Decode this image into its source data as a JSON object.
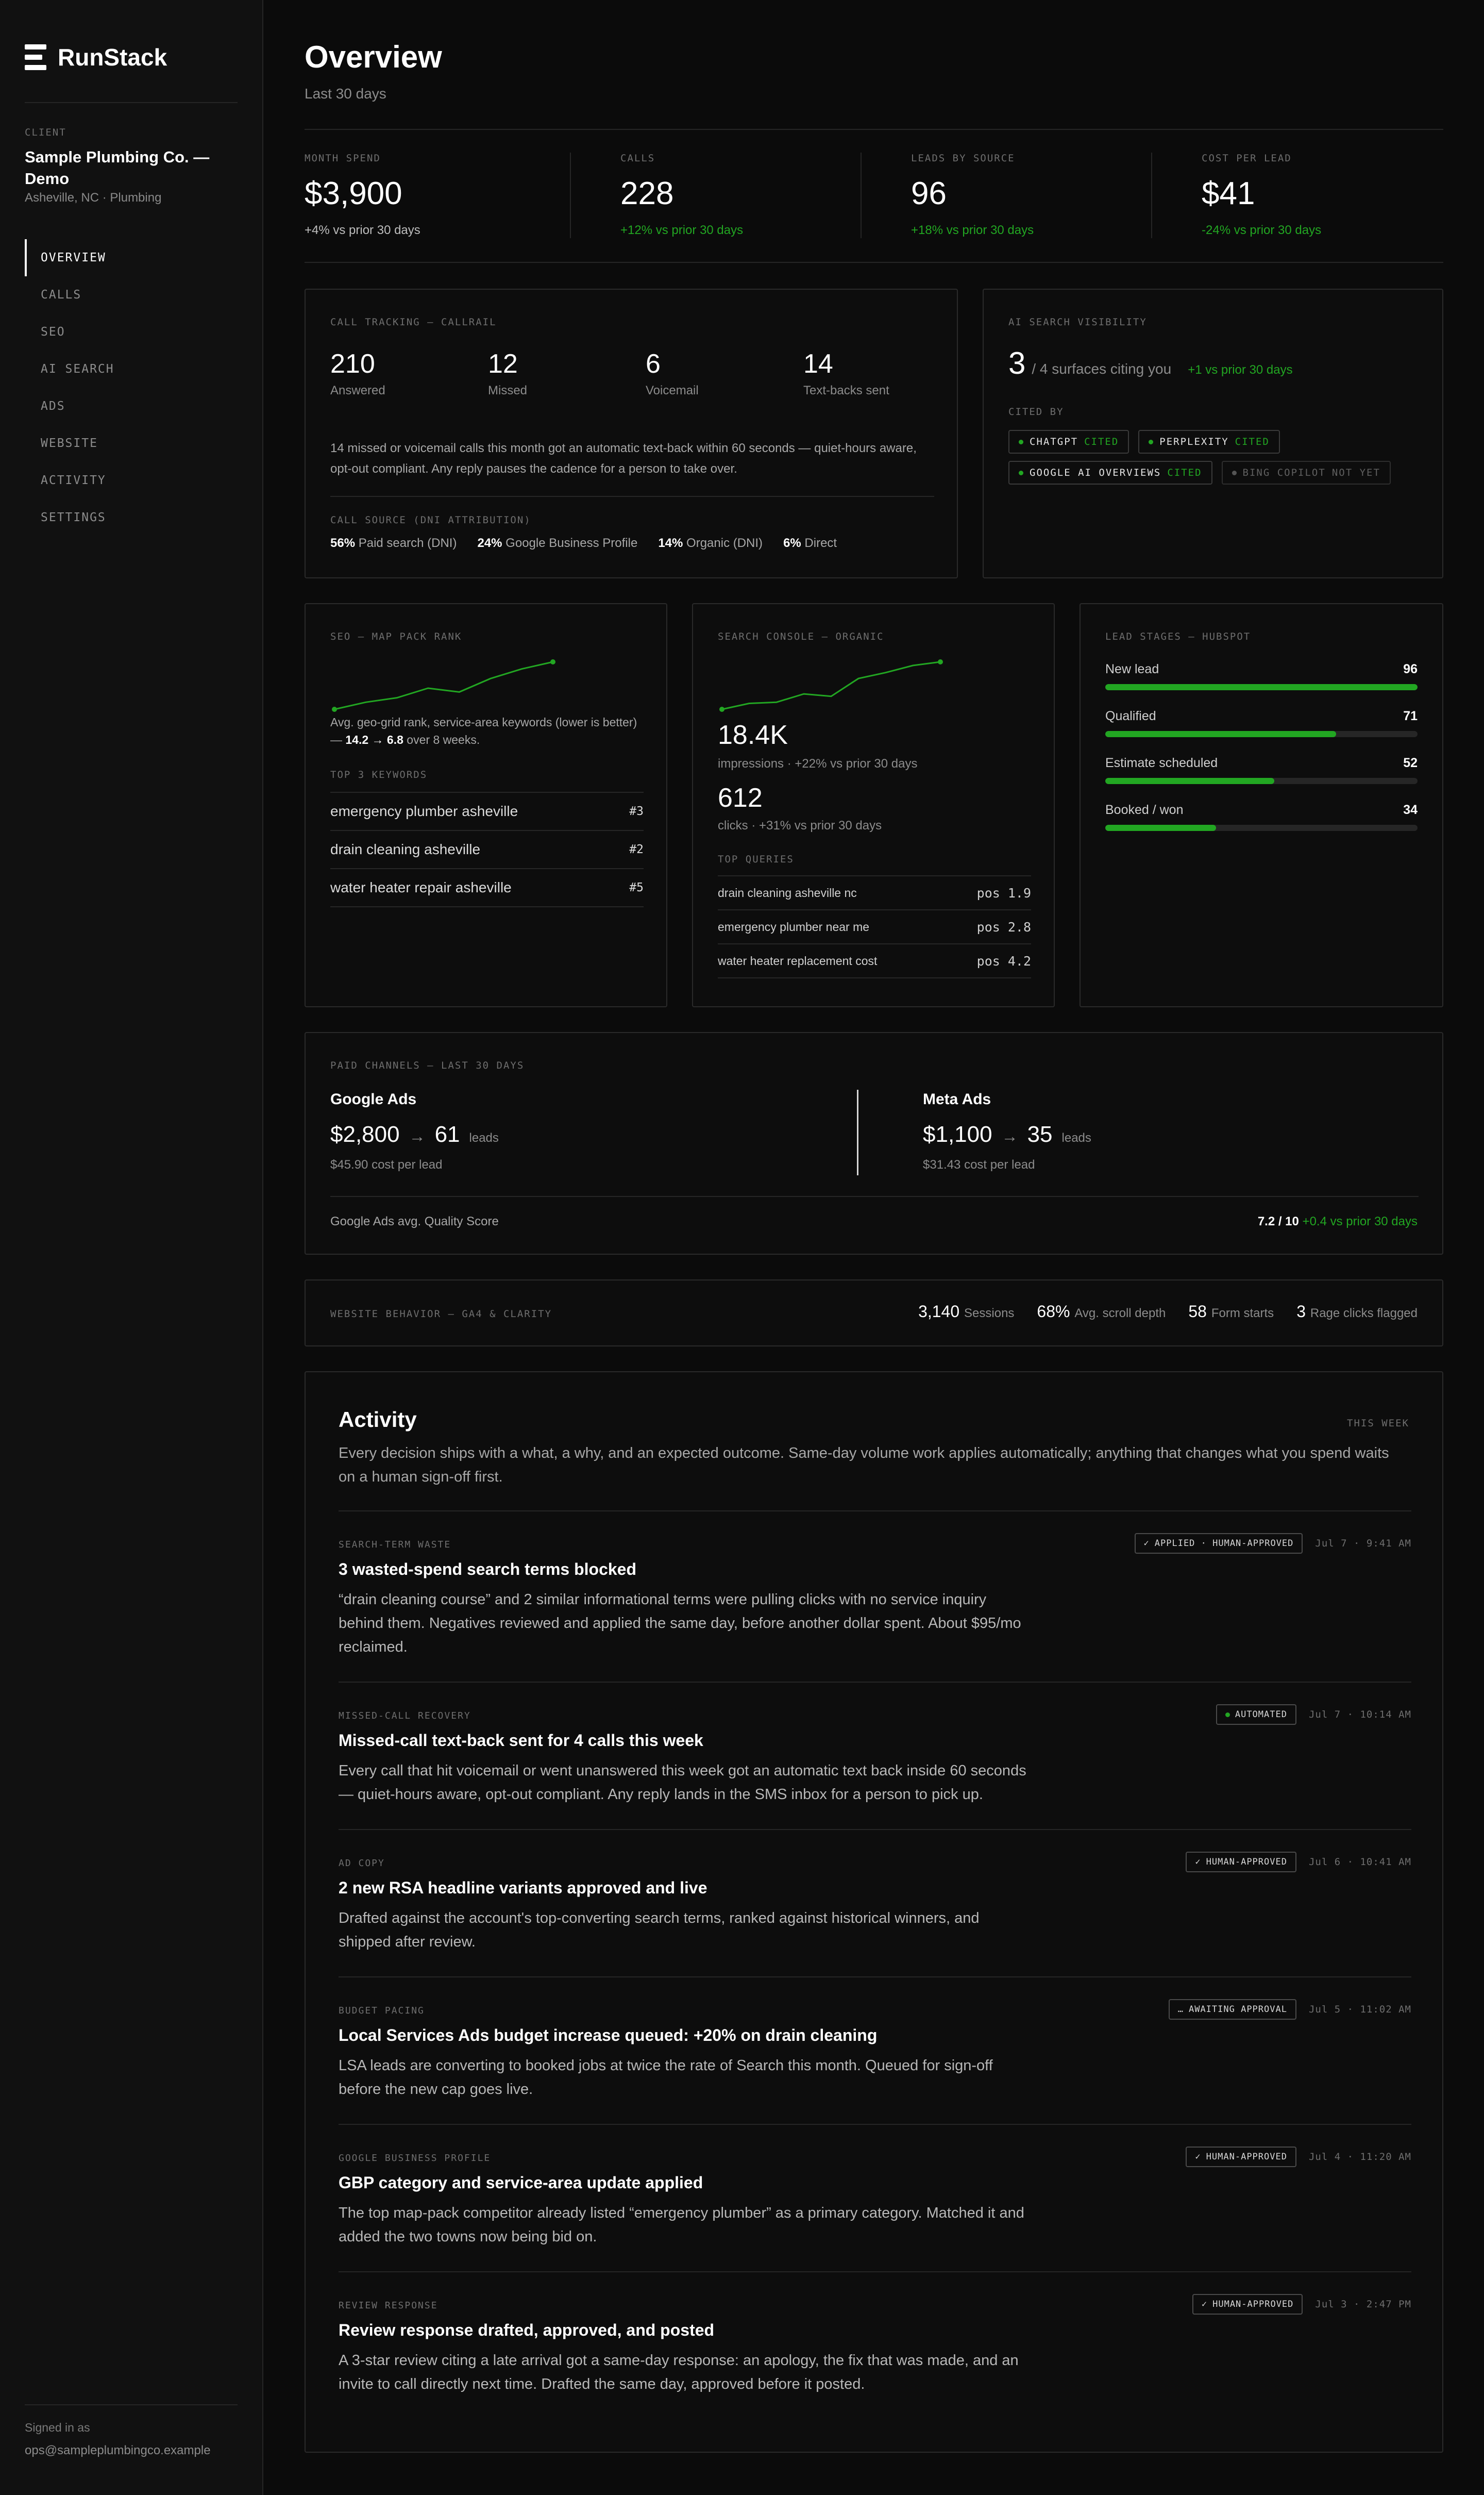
{
  "brand": {
    "name": "RunStack"
  },
  "client": {
    "caption": "CLIENT",
    "name": "Sample Plumbing Co. — Demo",
    "location": "Asheville, NC · Plumbing"
  },
  "nav": [
    "OVERVIEW",
    "CALLS",
    "SEO",
    "AI SEARCH",
    "ADS",
    "WEBSITE",
    "ACTIVITY",
    "SETTINGS"
  ],
  "nav_active": "OVERVIEW",
  "user": {
    "caption": "Signed in as",
    "email": "ops@sampleplumbingco.example"
  },
  "page": {
    "title": "Overview",
    "subtitle": "Last 30 days"
  },
  "kpis": [
    {
      "label": "MONTH SPEND",
      "value": "$3,900",
      "delta": "+4% vs prior 30 days",
      "positive": false
    },
    {
      "label": "CALLS",
      "value": "228",
      "delta": "+12% vs prior 30 days",
      "positive": true
    },
    {
      "label": "LEADS BY SOURCE",
      "value": "96",
      "delta": "+18% vs prior 30 days",
      "positive": true
    },
    {
      "label": "COST PER LEAD",
      "value": "$41",
      "delta": "-24% vs prior 30 days",
      "positive": true
    }
  ],
  "call_tracking": {
    "caption": "CALL TRACKING — CALLRAIL",
    "stats": [
      {
        "value": "210",
        "label": "Answered",
        "highlight": false
      },
      {
        "value": "12",
        "label": "Missed",
        "highlight": false
      },
      {
        "value": "6",
        "label": "Voicemail",
        "highlight": false
      },
      {
        "value": "14",
        "label": "Text-backs sent",
        "highlight": true
      }
    ],
    "note": "14 missed or voicemail calls this month got an automatic text-back within 60 seconds — quiet-hours aware, opt-out compliant. Any reply pauses the cadence for a person to take over.",
    "source_caption": "CALL SOURCE (DNI ATTRIBUTION)",
    "sources": [
      {
        "pct": "56%",
        "label": "Paid search (DNI)"
      },
      {
        "pct": "24%",
        "label": "Google Business Profile"
      },
      {
        "pct": "14%",
        "label": "Organic (DNI)"
      },
      {
        "pct": "6%",
        "label": "Direct"
      }
    ]
  },
  "ai_search": {
    "caption": "AI SEARCH VISIBILITY",
    "count": "3",
    "of_text": "/ 4 surfaces citing you",
    "delta": "+1 vs prior 30 days",
    "cited_caption": "CITED BY",
    "surfaces": [
      {
        "name": "CHATGPT",
        "status": "CITED",
        "cited": true
      },
      {
        "name": "PERPLEXITY",
        "status": "CITED",
        "cited": true
      },
      {
        "name": "GOOGLE AI OVERVIEWS",
        "status": "CITED",
        "cited": true
      },
      {
        "name": "BING COPILOT",
        "status": "NOT YET",
        "cited": false
      }
    ]
  },
  "seo": {
    "caption": "SEO — MAP PACK RANK",
    "note_a": "Avg. geo-grid rank, service-area keywords (lower is better) — ",
    "rank_change": "14.2 → 6.8",
    "note_b": " over 8 weeks.",
    "rank_series": [
      14.2,
      13.1,
      12.4,
      10.9,
      11.5,
      9.4,
      7.9,
      6.8
    ],
    "kw_caption": "TOP 3 KEYWORDS",
    "keywords": [
      {
        "kw": "emergency plumber asheville",
        "rank": "#3"
      },
      {
        "kw": "drain cleaning asheville",
        "rank": "#2"
      },
      {
        "kw": "water heater repair asheville",
        "rank": "#5"
      }
    ]
  },
  "search_console": {
    "caption": "SEARCH CONSOLE — ORGANIC",
    "series": [
      1.0,
      1.25,
      1.3,
      1.65,
      1.55,
      2.3,
      2.55,
      2.85,
      3.0
    ],
    "impressions": "18.4K",
    "impressions_label": "impressions · +22% vs prior 30 days",
    "clicks": "612",
    "clicks_label": "clicks · +31% vs prior 30 days",
    "q_caption": "TOP QUERIES",
    "queries": [
      {
        "q": "drain cleaning asheville nc",
        "pos": "pos 1.9"
      },
      {
        "q": "emergency plumber near me",
        "pos": "pos 2.8"
      },
      {
        "q": "water heater replacement cost",
        "pos": "pos 4.2"
      }
    ]
  },
  "lead_stages": {
    "caption": "LEAD STAGES — HUBSPOT",
    "stages": [
      {
        "name": "New lead",
        "value": 96
      },
      {
        "name": "Qualified",
        "value": 71
      },
      {
        "name": "Estimate scheduled",
        "value": 52
      },
      {
        "name": "Booked / won",
        "value": 34
      }
    ]
  },
  "paid": {
    "caption": "PAID CHANNELS — LAST 30 DAYS",
    "channels": [
      {
        "name": "Google Ads",
        "spend": "$2,800",
        "arrow": "→",
        "leads": "61",
        "leads_label": "leads",
        "cpl": "$45.90 cost per lead"
      },
      {
        "name": "Meta Ads",
        "spend": "$1,100",
        "arrow": "→",
        "leads": "35",
        "leads_label": "leads",
        "cpl": "$31.43 cost per lead"
      }
    ],
    "qs_label": "Google Ads avg. Quality Score",
    "qs_value": "7.2 / 10",
    "qs_delta": "+0.4 vs prior 30 days"
  },
  "website": {
    "caption": "WEBSITE BEHAVIOR — GA4 & CLARITY",
    "metrics": [
      {
        "value": "3,140",
        "label": "Sessions"
      },
      {
        "value": "68%",
        "label": "Avg. scroll depth"
      },
      {
        "value": "58",
        "label": "Form starts"
      },
      {
        "value": "3",
        "label": "Rage clicks flagged"
      }
    ]
  },
  "activity": {
    "title": "Activity",
    "period": "THIS WEEK",
    "intro": "Every decision ships with a what, a why, and an expected outcome. Same-day volume work applies automatically; anything that changes what you spend waits on a human sign-off first.",
    "items": [
      {
        "category": "SEARCH-TERM WASTE",
        "title": "3 wasted-spend search terms blocked",
        "body": "“drain cleaning course” and 2 similar informational terms were pulling clicks with no service inquiry behind them. Negatives reviewed and applied the same day, before another dollar spent. About $95/mo reclaimed.",
        "badge": "APPLIED · HUMAN-APPROVED",
        "badge_icon": "✓",
        "time": "Jul 7 · 9:41 AM"
      },
      {
        "category": "MISSED-CALL RECOVERY",
        "title": "Missed-call text-back sent for 4 calls this week",
        "body": "Every call that hit voicemail or went unanswered this week got an automatic text back inside 60 seconds — quiet-hours aware, opt-out compliant. Any reply lands in the SMS inbox for a person to pick up.",
        "badge": "AUTOMATED",
        "badge_icon": "●",
        "time": "Jul 7 · 10:14 AM"
      },
      {
        "category": "AD COPY",
        "title": "2 new RSA headline variants approved and live",
        "body": "Drafted against the account's top-converting search terms, ranked against historical winners, and shipped after review.",
        "badge": "HUMAN-APPROVED",
        "badge_icon": "✓",
        "time": "Jul 6 · 10:41 AM"
      },
      {
        "category": "BUDGET PACING",
        "title": "Local Services Ads budget increase queued: +20% on drain cleaning",
        "body": "LSA leads are converting to booked jobs at twice the rate of Search this month. Queued for sign-off before the new cap goes live.",
        "badge": "AWAITING APPROVAL",
        "badge_icon": "…",
        "time": "Jul 5 · 11:02 AM"
      },
      {
        "category": "GOOGLE BUSINESS PROFILE",
        "title": "GBP category and service-area update applied",
        "body": "The top map-pack competitor already listed “emergency plumber” as a primary category. Matched it and added the two towns now being bid on.",
        "badge": "HUMAN-APPROVED",
        "badge_icon": "✓",
        "time": "Jul 4 · 11:20 AM"
      },
      {
        "category": "REVIEW RESPONSE",
        "title": "Review response drafted, approved, and posted",
        "body": "A 3-star review citing a late arrival got a same-day response: an apology, the fix that was made, and an invite to call directly next time. Drafted the same day, approved before it posted.",
        "badge": "HUMAN-APPROVED",
        "badge_icon": "✓",
        "time": "Jul 3 · 2:47 PM"
      }
    ]
  }
}
